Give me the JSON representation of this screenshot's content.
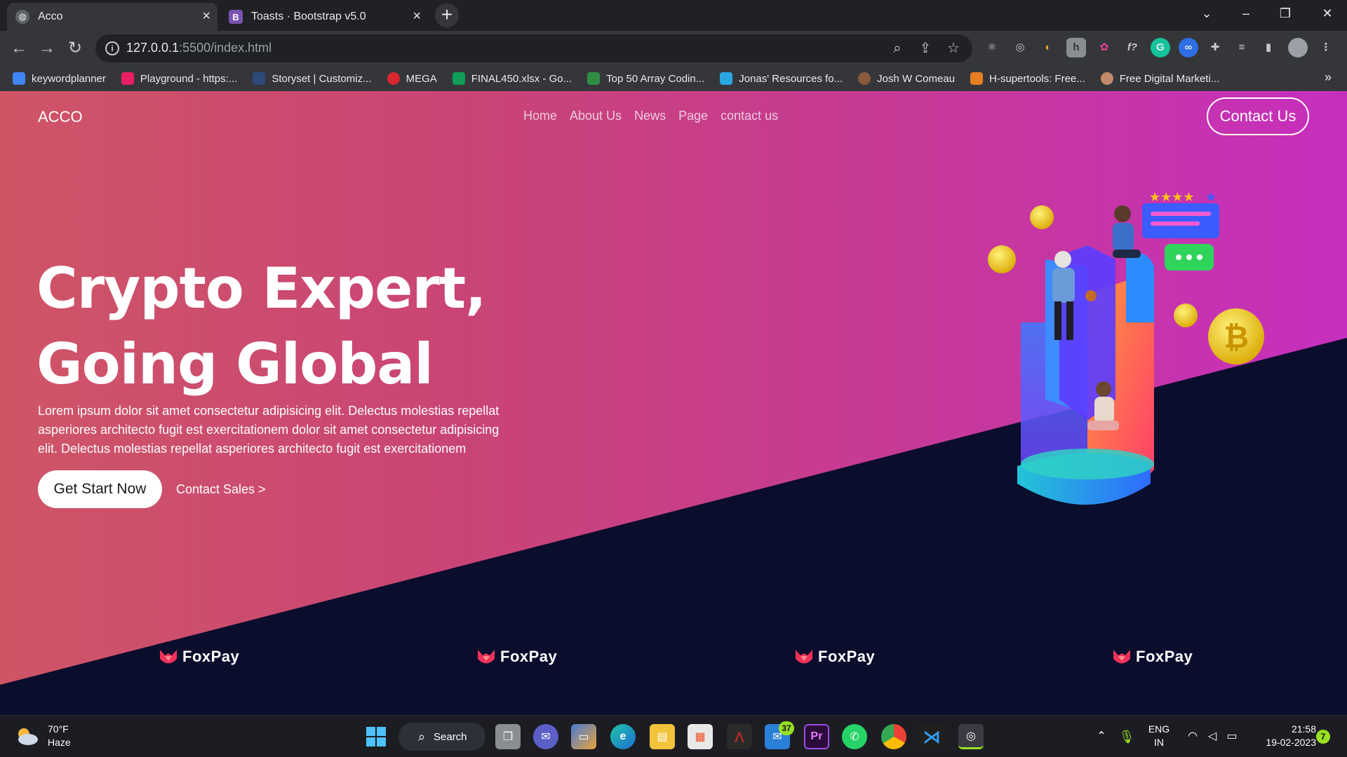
{
  "browser": {
    "tabs": [
      {
        "title": "Acco",
        "active": true
      },
      {
        "title": "Toasts · Bootstrap v5.0",
        "active": false
      }
    ],
    "url_host": "127.0.0.1",
    "url_path": ":5500/index.html",
    "bookmarks": [
      {
        "label": "keywordplanner",
        "color": "#4285f4"
      },
      {
        "label": "Playground - https:...",
        "color": "#e91e63"
      },
      {
        "label": "Storyset | Customiz...",
        "color": "#2c4a7a"
      },
      {
        "label": "MEGA",
        "color": "#d9272e"
      },
      {
        "label": "FINAL450.xlsx - Go...",
        "color": "#0f9d58"
      },
      {
        "label": "Top 50 Array Codin...",
        "color": "#2f8d46"
      },
      {
        "label": "Jonas' Resources fo...",
        "color": "#2aa7e0"
      },
      {
        "label": "Josh W Comeau",
        "color": "#8a5a3c"
      },
      {
        "label": "H-supertools: Free...",
        "color": "#e67e22"
      },
      {
        "label": "Free Digital Marketi...",
        "color": "#c08a6a"
      }
    ],
    "bookmarks_more": "»"
  },
  "site": {
    "brand": "ACCO",
    "nav": [
      "Home",
      "About Us",
      "News",
      "Page",
      "contact us"
    ],
    "contact_button": "Contact Us",
    "headline_line1": "Crypto Expert,",
    "headline_line2": "Going Global",
    "description": "Lorem ipsum dolor sit amet consectetur adipisicing elit. Delectus molestias repellat asperiores architecto fugit est exercitationem dolor sit amet consectetur adipisicing elit. Delectus molestias repellat asperiores architecto fugit est exercitationem",
    "cta_primary": "Get Start Now",
    "cta_secondary": "Contact Sales >",
    "partner_logos": [
      "FoxPay",
      "FoxPay",
      "FoxPay",
      "FoxPay"
    ]
  },
  "taskbar": {
    "weather_temp": "70°F",
    "weather_desc": "Haze",
    "search_label": "Search",
    "mail_badge": "37",
    "lang_line1": "ENG",
    "lang_line2": "IN",
    "time": "21:58",
    "date": "19-02-2023",
    "notif_count": "7"
  },
  "colors": {
    "hero_gradient_start": "#cf5566",
    "hero_gradient_end": "#c62fbd",
    "dark_bg": "#0a0d2c"
  }
}
